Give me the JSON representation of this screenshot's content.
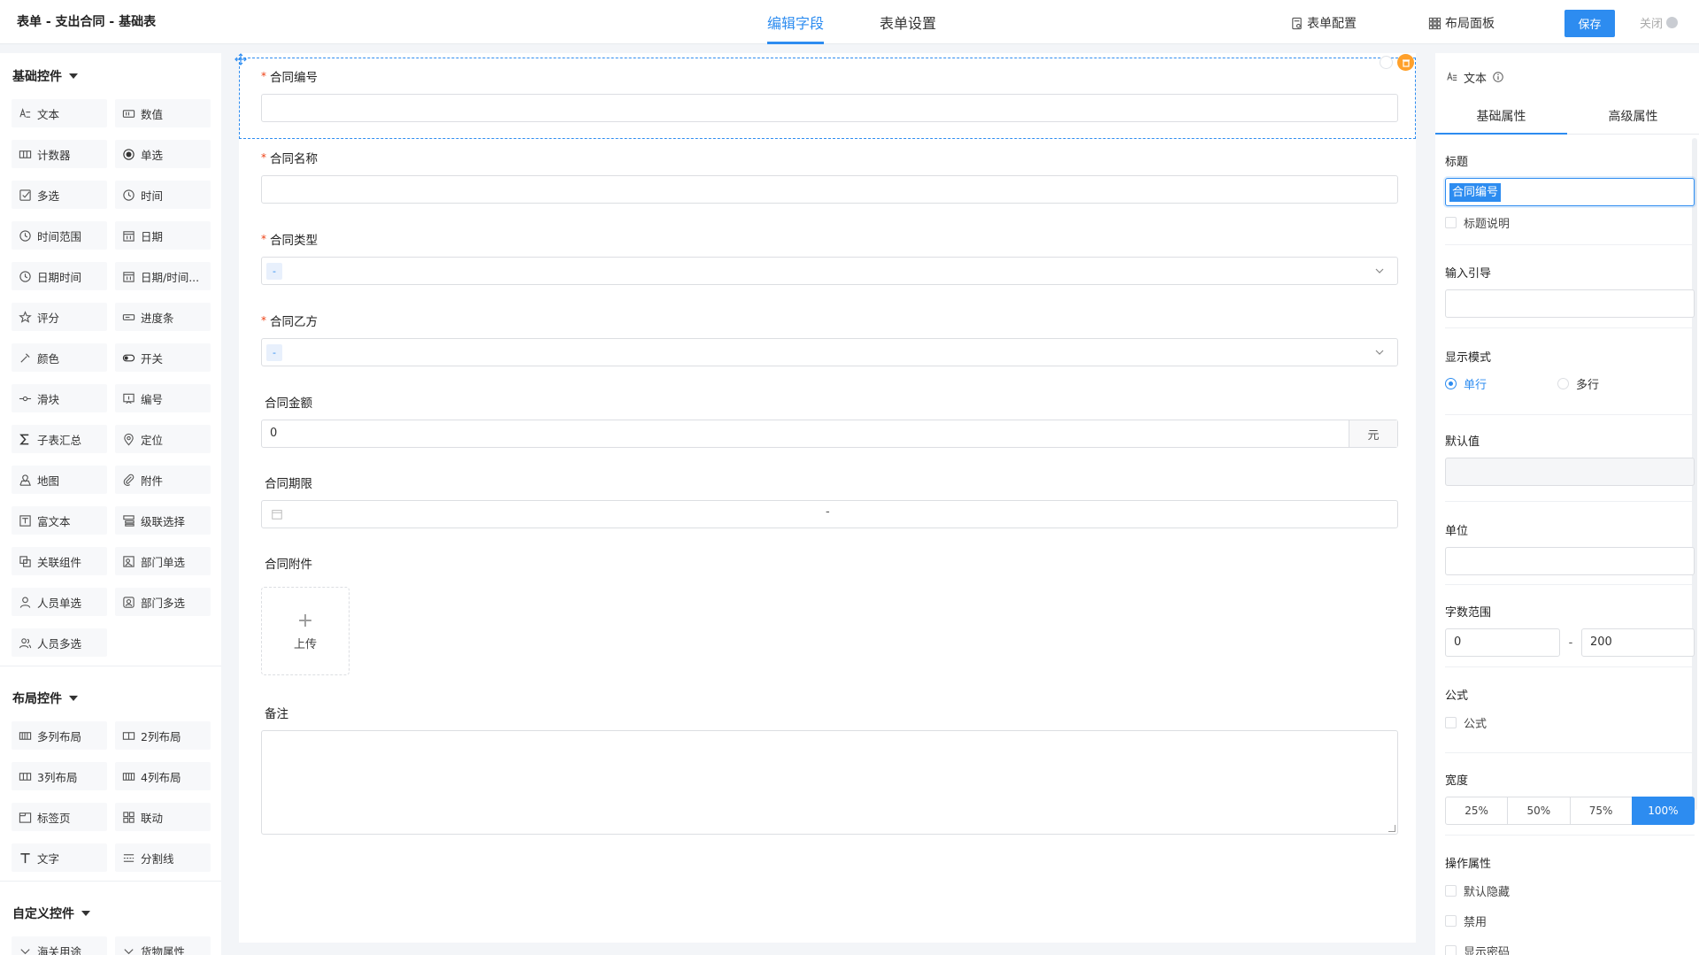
{
  "header": {
    "title": "表单 - 支出合同 - 基础表",
    "tabs": [
      {
        "label": "编辑字段"
      },
      {
        "label": "表单设置"
      }
    ],
    "actions": {
      "form_config": "表单配置",
      "layout_panel": "布局面板"
    },
    "save": "保存",
    "close": "关闭"
  },
  "palette": {
    "groups": [
      {
        "title": "基础控件",
        "items": [
          {
            "label": "文本",
            "icon": "text-icon"
          },
          {
            "label": "数值",
            "icon": "number-icon"
          },
          {
            "label": "计数器",
            "icon": "counter-icon"
          },
          {
            "label": "单选",
            "icon": "radio-icon"
          },
          {
            "label": "多选",
            "icon": "checkbox-icon"
          },
          {
            "label": "时间",
            "icon": "clock-icon"
          },
          {
            "label": "时间范围",
            "icon": "clock-range-icon"
          },
          {
            "label": "日期",
            "icon": "calendar-icon"
          },
          {
            "label": "日期时间",
            "icon": "datetime-icon"
          },
          {
            "label": "日期/时间...",
            "icon": "calendar-range-icon"
          },
          {
            "label": "评分",
            "icon": "star-icon"
          },
          {
            "label": "进度条",
            "icon": "progress-icon"
          },
          {
            "label": "颜色",
            "icon": "eyedropper-icon"
          },
          {
            "label": "开关",
            "icon": "toggle-icon"
          },
          {
            "label": "滑块",
            "icon": "slider-icon"
          },
          {
            "label": "编号",
            "icon": "serial-icon"
          },
          {
            "label": "子表汇总",
            "icon": "sigma-icon"
          },
          {
            "label": "定位",
            "icon": "location-icon"
          },
          {
            "label": "地图",
            "icon": "map-icon"
          },
          {
            "label": "附件",
            "icon": "paperclip-icon"
          },
          {
            "label": "富文本",
            "icon": "richtext-icon"
          },
          {
            "label": "级联选择",
            "icon": "cascader-icon"
          },
          {
            "label": "关联组件",
            "icon": "link-component-icon"
          },
          {
            "label": "部门单选",
            "icon": "department-icon"
          },
          {
            "label": "人员单选",
            "icon": "user-icon"
          },
          {
            "label": "部门多选",
            "icon": "departments-icon"
          },
          {
            "label": "人员多选",
            "icon": "users-icon"
          }
        ]
      },
      {
        "title": "布局控件",
        "items": [
          {
            "label": "多列布局",
            "icon": "multi-column-icon"
          },
          {
            "label": "2列布局",
            "icon": "two-column-icon"
          },
          {
            "label": "3列布局",
            "icon": "three-column-icon"
          },
          {
            "label": "4列布局",
            "icon": "four-column-icon"
          },
          {
            "label": "标签页",
            "icon": "tabs-icon"
          },
          {
            "label": "联动",
            "icon": "linkage-icon"
          },
          {
            "label": "文字",
            "icon": "letter-t-icon"
          },
          {
            "label": "分割线",
            "icon": "divider-icon"
          }
        ]
      },
      {
        "title": "自定义控件",
        "items": [
          {
            "label": "海关用途",
            "icon": "custom-icon"
          },
          {
            "label": "货物属性",
            "icon": "custom-icon"
          }
        ]
      }
    ]
  },
  "form": {
    "fields": [
      {
        "label": "合同编号",
        "required": "*",
        "type": "text"
      },
      {
        "label": "合同名称",
        "required": "*",
        "type": "text"
      },
      {
        "label": "合同类型",
        "required": "*",
        "type": "select",
        "value": "-"
      },
      {
        "label": "合同乙方",
        "required": "*",
        "type": "select",
        "value": "-"
      },
      {
        "label": "合同金额",
        "required": "",
        "type": "number",
        "value": "0",
        "suffix": "元"
      },
      {
        "label": "合同期限",
        "required": "",
        "type": "daterange",
        "separator": "-"
      },
      {
        "label": "合同附件",
        "required": "",
        "type": "upload",
        "upload_text": "上传",
        "plus": "+"
      },
      {
        "label": "备注",
        "required": "",
        "type": "textarea"
      }
    ]
  },
  "props": {
    "component_name": "文本",
    "tabs": [
      {
        "label": "基础属性"
      },
      {
        "label": "高级属性"
      }
    ],
    "title_label": "标题",
    "title_value": "合同编号",
    "title_desc": "标题说明",
    "placeholder_label": "输入引导",
    "display_mode_label": "显示模式",
    "display_modes": [
      "单行",
      "多行"
    ],
    "default_label": "默认值",
    "unit_label": "单位",
    "length_label": "字数范围",
    "length_min": "0",
    "length_max": "200",
    "length_sep": "-",
    "formula_label": "公式",
    "formula_check": "公式",
    "width_label": "宽度",
    "widths": [
      "25%",
      "50%",
      "75%",
      "100%"
    ],
    "ops_label": "操作属性",
    "ops": [
      "默认隐藏",
      "禁用",
      "显示密码"
    ]
  },
  "colors": {
    "accent": "#2d8cf0",
    "required": "#ed4014",
    "delete": "#ffa02a"
  }
}
